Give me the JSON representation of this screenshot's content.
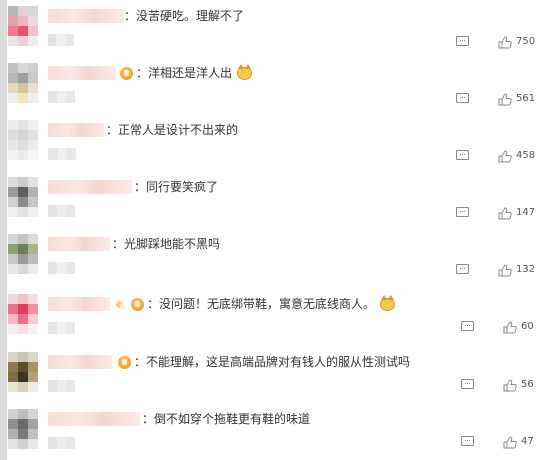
{
  "comments": [
    {
      "text": "：没苦硬吃。理解不了",
      "likes": "750",
      "reply_icon": "reply-icon",
      "like_icon": "thumbs-up-icon",
      "badge": false,
      "emoji": false
    },
    {
      "text": "：洋相还是洋人出",
      "likes": "561",
      "reply_icon": "reply-icon",
      "like_icon": "thumbs-up-icon",
      "badge": true,
      "emoji": true
    },
    {
      "text": "：正常人是设计不出来的",
      "likes": "458",
      "reply_icon": "reply-icon",
      "like_icon": "thumbs-up-icon",
      "badge": false,
      "emoji": false
    },
    {
      "text": "：同行要笑疯了",
      "likes": "147",
      "reply_icon": "reply-icon",
      "like_icon": "thumbs-up-icon",
      "badge": false,
      "emoji": false
    },
    {
      "text": "：光脚踩地能不黑吗",
      "likes": "132",
      "reply_icon": "reply-icon",
      "like_icon": "thumbs-up-icon",
      "badge": false,
      "emoji": false
    },
    {
      "text": "：没问题！无底绑带鞋，寓意无底线商人。",
      "likes": "60",
      "reply_icon": "reply-icon",
      "like_icon": "thumbs-up-icon",
      "badge": true,
      "emoji": true
    },
    {
      "text": "：不能理解，这是高端品牌对有钱人的服从性测试吗",
      "likes": "56",
      "reply_icon": "reply-icon",
      "like_icon": "thumbs-up-icon",
      "badge": true,
      "emoji": false
    },
    {
      "text": "：倒不如穿个拖鞋更有鞋的味道",
      "likes": "47",
      "reply_icon": "reply-icon",
      "like_icon": "thumbs-up-icon",
      "badge": false,
      "emoji": false
    }
  ]
}
